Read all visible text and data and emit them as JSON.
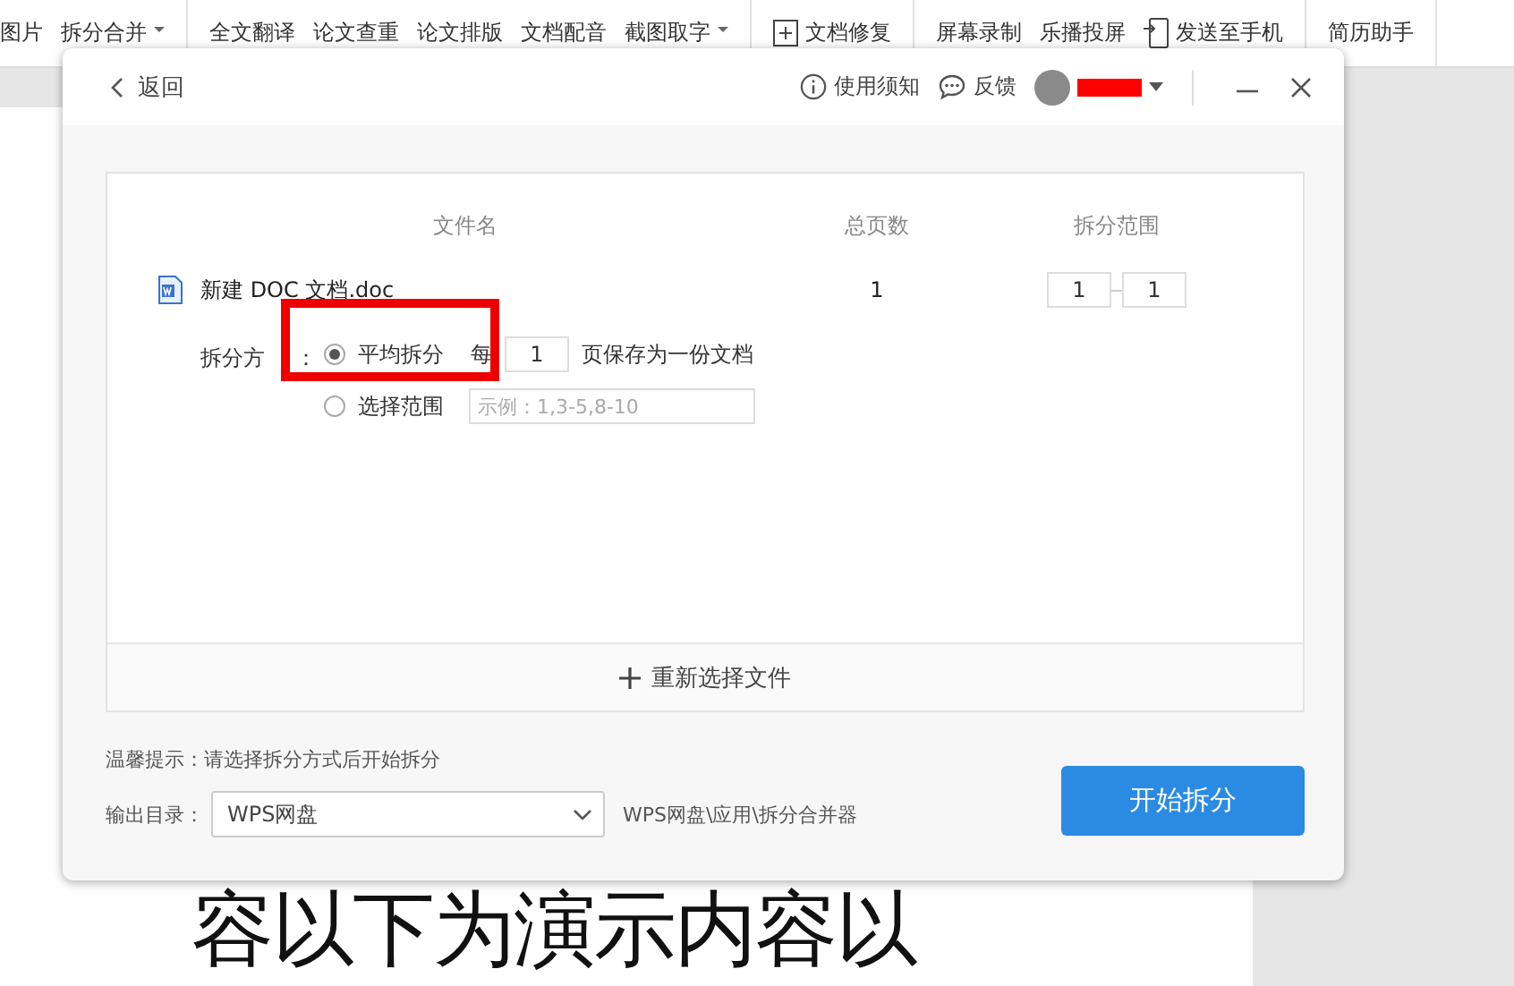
{
  "toolbar": {
    "groups": [
      {
        "items": [
          {
            "label": "图片",
            "kind": "plain"
          },
          {
            "label": "拆分合并",
            "kind": "dropdown"
          }
        ]
      },
      {
        "items": [
          {
            "label": "全文翻译",
            "kind": "plain"
          },
          {
            "label": "论文查重",
            "kind": "plain"
          },
          {
            "label": "论文排版",
            "kind": "plain"
          },
          {
            "label": "文档配音",
            "kind": "plain"
          },
          {
            "label": "截图取字",
            "kind": "dropdown"
          }
        ]
      },
      {
        "items": [
          {
            "label": "文档修复",
            "kind": "repair"
          }
        ]
      },
      {
        "items": [
          {
            "label": "屏幕录制",
            "kind": "plain"
          },
          {
            "label": "乐播投屏",
            "kind": "plain"
          },
          {
            "label": "发送至手机",
            "kind": "phone"
          }
        ]
      },
      {
        "items": [
          {
            "label": "简历助手",
            "kind": "plain"
          }
        ]
      }
    ]
  },
  "document": {
    "line": "容以下为演示内容以"
  },
  "dialog": {
    "back": "返回",
    "help": "使用须知",
    "feedback": "反馈",
    "table": {
      "columns": [
        "文件名",
        "总页数",
        "拆分范围"
      ],
      "file": {
        "name": "新建 DOC 文档.doc",
        "pages": "1",
        "range_from": "1",
        "range_to": "1"
      }
    },
    "method": {
      "label": "拆分方",
      "colon": "：",
      "options": [
        {
          "kind": "average",
          "label": "平均拆分",
          "selected": true,
          "prefix": "每",
          "value": "1",
          "suffix": "页保存为一份文档"
        },
        {
          "kind": "range",
          "label": "选择范围",
          "selected": false,
          "placeholder": "示例：1,3-5,8-10"
        }
      ]
    },
    "reselect": "重新选择文件",
    "tip": "温馨提示：请选择拆分方式后开始拆分",
    "output": {
      "label": "输出目录：",
      "value": "WPS网盘",
      "path": "WPS网盘\\应用\\拆分合并器"
    },
    "start": "开始拆分"
  }
}
